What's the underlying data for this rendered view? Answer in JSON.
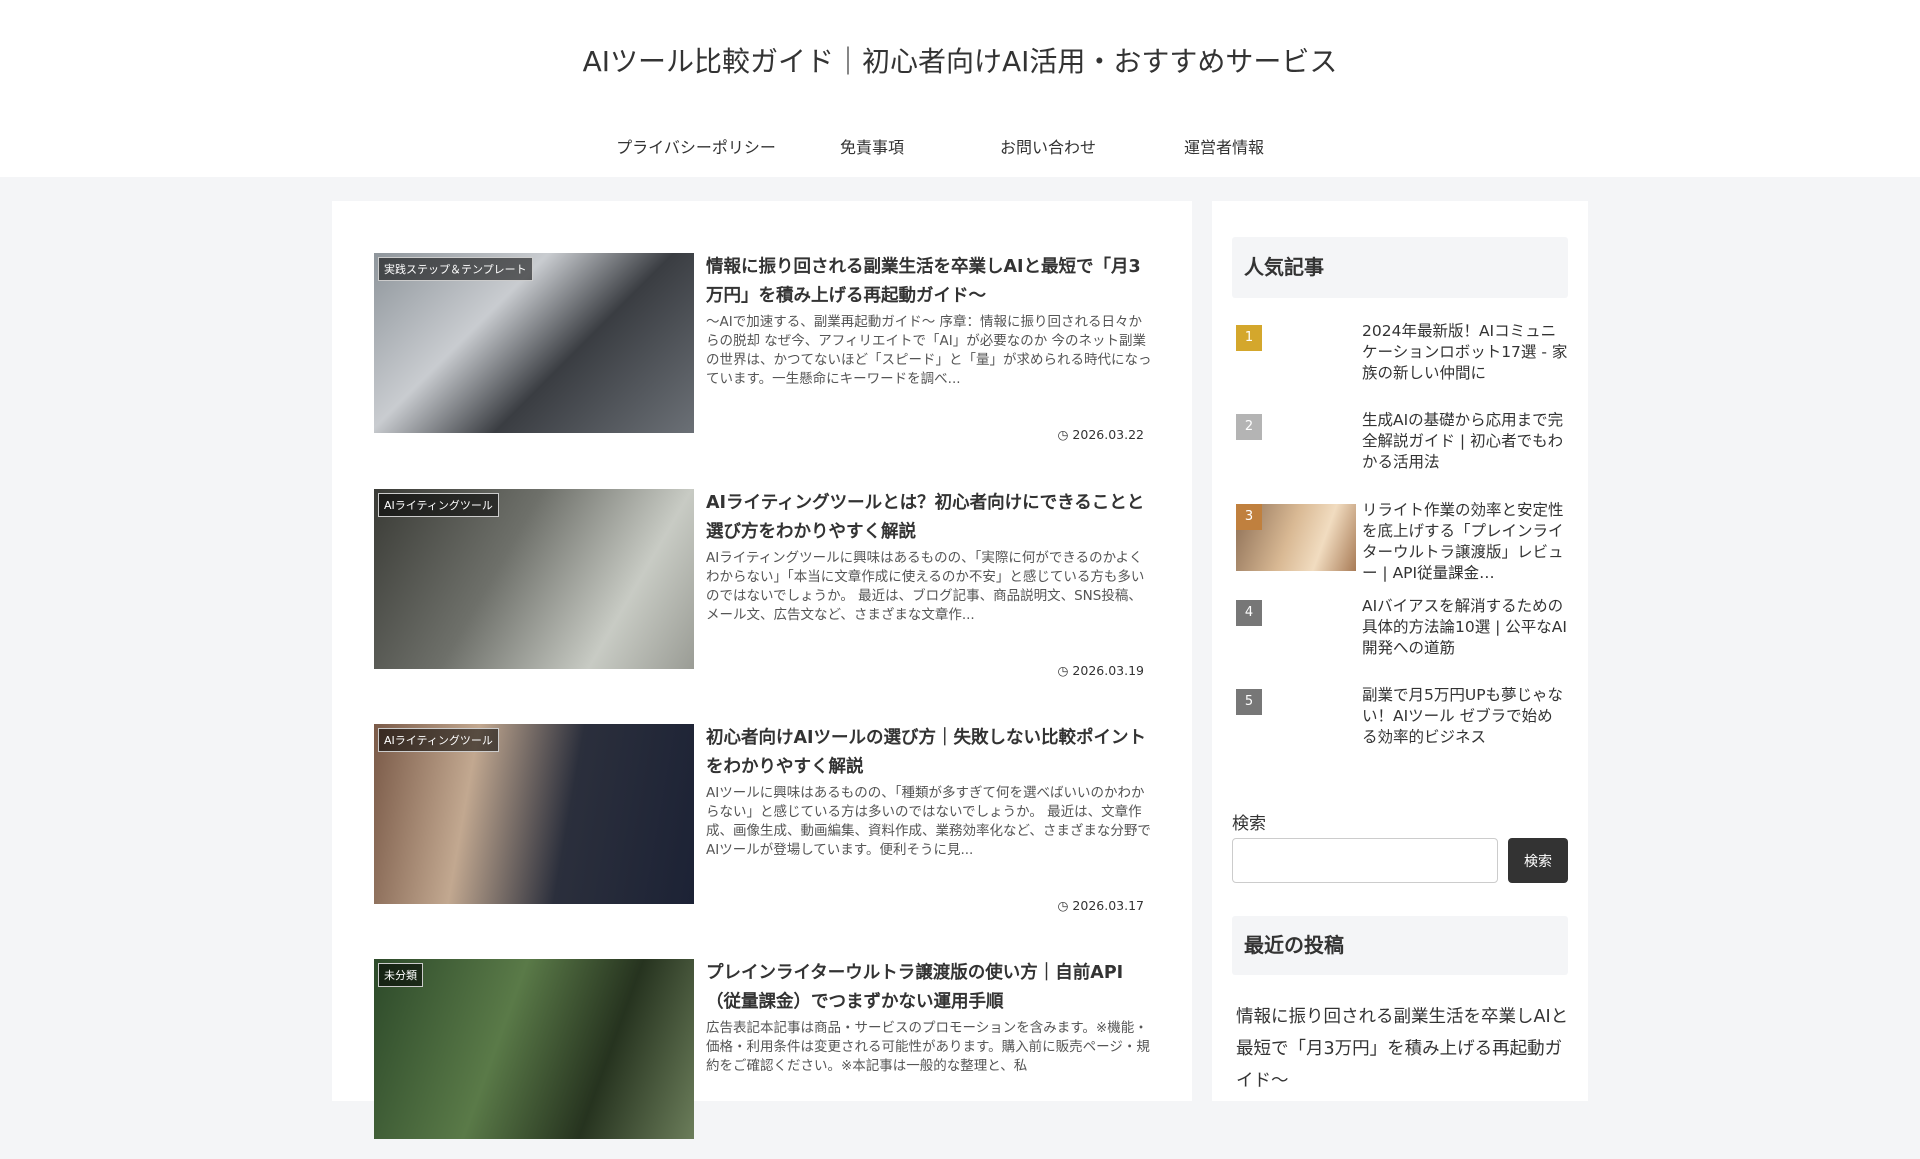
{
  "site_title": "AIツール比較ガイド｜初心者向けAI活用・おすすめサービス",
  "nav": [
    "プライバシーポリシー",
    "免責事項",
    "お問い合わせ",
    "運営者情報"
  ],
  "articles": [
    {
      "category": "実践ステップ＆テンプレート",
      "title": "情報に振り回される副業生活を卒業しAIと最短で「月3万円」を積み上げる再起動ガイド〜",
      "snippet": "〜AIで加速する、副業再起動ガイド〜 序章：情報に振り回される日々からの脱却 なぜ今、アフィリエイトで「AI」が必要なのか 今のネット副業の世界は、かつてないほど「スピード」と「量」が求められる時代になっています。一生懸命にキーワードを調べ...",
      "date": "2026.03.22"
    },
    {
      "category": "AIライティングツール",
      "title": "AIライティングツールとは？初心者向けにできることと選び方をわかりやすく解説",
      "snippet": "AIライティングツールに興味はあるものの、「実際に何ができるのかよくわからない」「本当に文章作成に使えるのか不安」と感じている方も多いのではないでしょうか。 最近は、ブログ記事、商品説明文、SNS投稿、メール文、広告文など、さまざまな文章作...",
      "date": "2026.03.19"
    },
    {
      "category": "AIライティングツール",
      "title": "初心者向けAIツールの選び方｜失敗しない比較ポイントをわかりやすく解説",
      "snippet": "AIツールに興味はあるものの、「種類が多すぎて何を選べばいいのかわからない」と感じている方は多いのではないでしょうか。 最近は、文章作成、画像生成、動画編集、資料作成、業務効率化など、さまざまな分野でAIツールが登場しています。便利そうに見...",
      "date": "2026.03.17"
    },
    {
      "category": "未分類",
      "title": "プレインライターウルトラ譲渡版の使い方｜自前API（従量課金）でつまずかない運用手順",
      "snippet": "広告表記本記事は商品・サービスのプロモーションを含みます。※機能・価格・利用条件は変更される可能性があります。購入前に販売ページ・規約をご確認ください。※本記事は一般的な整理と、私",
      "date": ""
    }
  ],
  "sidebar": {
    "popular_heading": "人気記事",
    "popular": [
      {
        "rank": "1",
        "title": "2024年最新版！AIコミュニケーションロボット17選 - 家族の新しい仲間に",
        "color": "#d4a72c"
      },
      {
        "rank": "2",
        "title": "生成AIの基礎から応用まで完全解説ガイド | 初心者でもわかる活用法",
        "color": "#b4b4b4"
      },
      {
        "rank": "3",
        "title": "リライト作業の効率と安定性を底上げする「プレインライターウルトラ譲渡版」レビュー | API従量課金…",
        "color": "#c0803e"
      },
      {
        "rank": "4",
        "title": "AIバイアスを解消するための具体的方法論10選 | 公平なAI開発への道筋",
        "color": "#777777"
      },
      {
        "rank": "5",
        "title": "副業で月5万円UPも夢じゃない！AIツール ゼブラで始める効率的ビジネス",
        "color": "#777777"
      }
    ],
    "search_label": "検索",
    "search_button": "検索",
    "search_value": "",
    "recent_heading": "最近の投稿",
    "recent": [
      "情報に振り回される副業生活を卒業しAIと最短で「月3万円」を積み上げる再起動ガイド〜"
    ]
  }
}
